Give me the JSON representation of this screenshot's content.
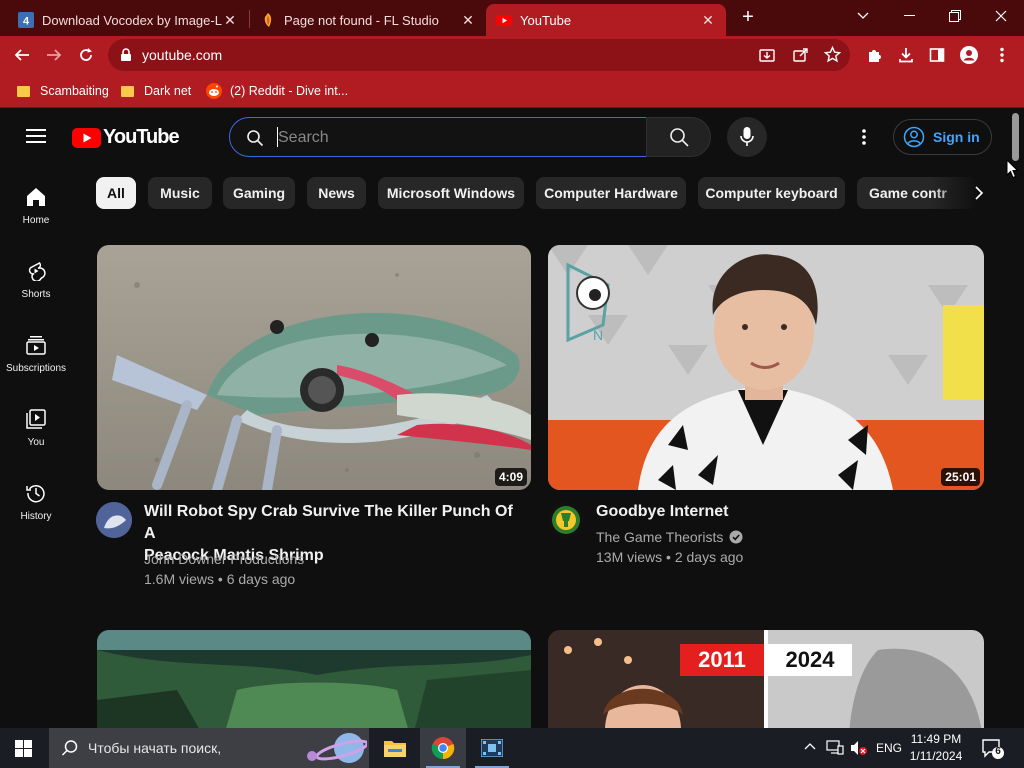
{
  "tabs": [
    {
      "title": "Download Vocodex by Image-Li",
      "favicon": "fl-download-icon"
    },
    {
      "title": "Page not found - FL Studio",
      "favicon": "fl-studio-icon"
    },
    {
      "title": "YouTube",
      "favicon": "youtube-icon",
      "active": true
    }
  ],
  "omnibox": {
    "url": "youtube.com"
  },
  "bookmarks": [
    {
      "label": "Scambaiting",
      "icon": "folder-icon"
    },
    {
      "label": "Dark net",
      "icon": "folder-icon"
    },
    {
      "label": "(2) Reddit - Dive int...",
      "icon": "reddit-icon"
    }
  ],
  "youtube": {
    "logo_text": "YouTube",
    "search_placeholder": "Search",
    "signin_label": "Sign in",
    "guide": [
      {
        "label": "Home",
        "icon": "home-icon"
      },
      {
        "label": "Shorts",
        "icon": "shorts-icon"
      },
      {
        "label": "Subscriptions",
        "icon": "subscriptions-icon"
      },
      {
        "label": "You",
        "icon": "you-icon"
      },
      {
        "label": "History",
        "icon": "history-icon"
      }
    ],
    "chips": [
      "All",
      "Music",
      "Gaming",
      "News",
      "Microsoft Windows",
      "Computer Hardware",
      "Computer keyboard",
      "Game contr"
    ],
    "videos": [
      {
        "title_line1": "Will Robot Spy Crab Survive The Killer Punch Of A",
        "title_line2": "Peacock Mantis Shrimp",
        "channel": "John Downer Productions",
        "views": "1.6M views",
        "age": "6 days ago",
        "duration": "4:09"
      },
      {
        "title_line1": "Goodbye Internet",
        "channel": "The Game Theorists",
        "verified": true,
        "views": "13M views",
        "age": "2 days ago",
        "duration": "25:01"
      }
    ],
    "next_row_thumb_text": [
      "2011",
      "2024"
    ],
    "accent_blue": "#3ea6ff",
    "brand_red": "#ff0000"
  },
  "taskbar": {
    "search_placeholder": "Чтобы начать поиск,",
    "language": "ENG",
    "time": "11:49 PM",
    "date": "1/11/2024",
    "notification_count": "6",
    "apps": [
      "file-explorer-icon",
      "chrome-icon",
      "video-editor-icon"
    ]
  }
}
